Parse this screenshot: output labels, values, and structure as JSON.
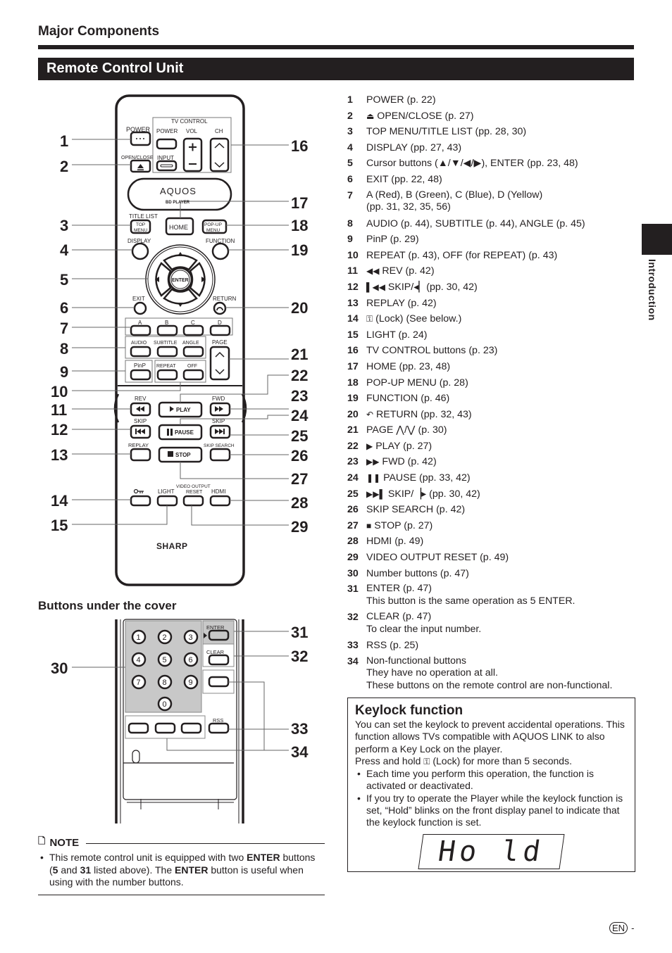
{
  "header": {
    "section_title": "Major Components",
    "page_title": "Remote Control Unit",
    "side_tab_label": "Introduction"
  },
  "remote": {
    "tv_control_label": "TV CONTROL",
    "power_label": "POWER",
    "tv_power_label": "POWER",
    "vol_label": "VOL",
    "ch_label": "CH",
    "open_close_label": "OPEN/CLOSE",
    "input_label": "INPUT",
    "brand_logo": "AQUOS",
    "brand_sub": "BD PLAYER",
    "title_list_label": "TITLE LIST",
    "top_menu_label_1": "TOP",
    "top_menu_label_2": "MENU",
    "home_label": "HOME",
    "popup_label_1": "POP-UP",
    "popup_label_2": "MENU",
    "display_label": "DISPLAY",
    "function_label": "FUNCTION",
    "enter_label": "ENTER",
    "exit_label": "EXIT",
    "return_label": "RETURN",
    "color_labels": [
      "A",
      "B",
      "C",
      "D"
    ],
    "audio_label": "AUDIO",
    "subtitle_label": "SUBTITLE",
    "angle_label": "ANGLE",
    "page_label": "PAGE",
    "pinp_label": "PinP",
    "repeat_label": "REPEAT",
    "off_label": "OFF",
    "rev_label": "REV",
    "play_label": "PLAY",
    "fwd_label": "FWD",
    "skip_label": "SKIP",
    "pause_label": "PAUSE",
    "replay_label": "REPLAY",
    "stop_label": "STOP",
    "skip_search_label": "SKIP SEARCH",
    "light_label": "LIGHT",
    "video_output_label": "VIDEO OUTPUT",
    "reset_label": "RESET",
    "hdmi_label": "HDMI",
    "maker_logo": "SHARP",
    "callouts_left": [
      "1",
      "2",
      "3",
      "4",
      "5",
      "6",
      "7",
      "8",
      "9",
      "10",
      "11",
      "12",
      "13",
      "14",
      "15"
    ],
    "callouts_right": [
      "16",
      "17",
      "18",
      "19",
      "20",
      "21",
      "22",
      "23",
      "24",
      "25",
      "26",
      "27",
      "28",
      "29"
    ]
  },
  "cover": {
    "heading": "Buttons under the cover",
    "digits": [
      "1",
      "2",
      "3",
      "4",
      "5",
      "6",
      "7",
      "8",
      "9",
      "0"
    ],
    "enter_label": "ENTER",
    "clear_label": "CLEAR",
    "rss_label": "RSS",
    "callouts": [
      "30",
      "31",
      "32",
      "33",
      "34"
    ]
  },
  "items": [
    {
      "num": "1",
      "text": "POWER (p. 22)"
    },
    {
      "num": "2",
      "icon": "eject-icon",
      "glyph": "⏏",
      "text": "OPEN/CLOSE (p. 27)"
    },
    {
      "num": "3",
      "text": "TOP MENU/TITLE LIST (pp. 28, 30)"
    },
    {
      "num": "4",
      "text": "DISPLAY (pp. 27, 43)"
    },
    {
      "num": "5",
      "text": "Cursor buttons (▲/▼/◀/▶), ENTER (pp. 23, 48)"
    },
    {
      "num": "6",
      "text": "EXIT (pp. 22, 48)"
    },
    {
      "num": "7",
      "text": "A (Red), B (Green), C (Blue), D (Yellow)",
      "text2": "(pp. 31, 32, 35, 56)"
    },
    {
      "num": "8",
      "text": "AUDIO (p. 44), SUBTITLE (p. 44), ANGLE (p. 45)"
    },
    {
      "num": "9",
      "text": "PinP (p. 29)"
    },
    {
      "num": "10",
      "text": "REPEAT (p. 43), OFF (for REPEAT) (p. 43)"
    },
    {
      "num": "11",
      "icon": "rewind-icon",
      "glyph": "◀◀",
      "text": "REV (p. 42)"
    },
    {
      "num": "12",
      "icon": "skip-back-icon",
      "glyph": "▌◀◀",
      "text": "SKIP/◂▏(pp. 30, 42)"
    },
    {
      "num": "13",
      "text": "REPLAY (p. 42)"
    },
    {
      "num": "14",
      "icon": "key-lock-icon",
      "glyph": "⚿",
      "text": "(Lock) (See below.)"
    },
    {
      "num": "15",
      "text": "LIGHT (p. 24)"
    },
    {
      "num": "16",
      "text": "TV CONTROL buttons (p. 23)"
    },
    {
      "num": "17",
      "text": "HOME (pp. 23, 48)"
    },
    {
      "num": "18",
      "text": "POP-UP MENU (p. 28)"
    },
    {
      "num": "19",
      "text": "FUNCTION (p. 46)"
    },
    {
      "num": "20",
      "icon": "return-icon",
      "glyph": "↶",
      "text": "RETURN (pp. 32, 43)"
    },
    {
      "num": "21",
      "text": "PAGE ⋀/⋁ (p. 30)"
    },
    {
      "num": "22",
      "icon": "play-icon",
      "glyph": "▶",
      "text": "PLAY (p. 27)"
    },
    {
      "num": "23",
      "icon": "fast-forward-icon",
      "glyph": "▶▶",
      "text": "FWD (p. 42)"
    },
    {
      "num": "24",
      "icon": "pause-icon",
      "glyph": "❚❚",
      "text": "PAUSE (pp. 33, 42)"
    },
    {
      "num": "25",
      "icon": "skip-forward-icon",
      "glyph": "▶▶▌",
      "text": "SKIP/▕▸ (pp. 30, 42)"
    },
    {
      "num": "26",
      "text": "SKIP SEARCH (p. 42)"
    },
    {
      "num": "27",
      "icon": "stop-icon",
      "glyph": "■",
      "text": "STOP (p. 27)"
    },
    {
      "num": "28",
      "text": "HDMI (p. 49)"
    },
    {
      "num": "29",
      "text": "VIDEO OUTPUT RESET (p. 49)"
    },
    {
      "num": "30",
      "text": "Number buttons (p. 47)"
    },
    {
      "num": "31",
      "text": "ENTER (p. 47)",
      "text2": "This button is the same operation as 5 ENTER."
    },
    {
      "num": "32",
      "text": "CLEAR (p. 47)",
      "text2": "To clear the input number."
    },
    {
      "num": "33",
      "text": "RSS (p. 25)"
    },
    {
      "num": "34",
      "text": "Non-functional buttons",
      "text2": "They have no operation at all.",
      "text3": "These buttons on the remote control are non-functional."
    }
  ],
  "keylock": {
    "title": "Keylock function",
    "para1": "You can set the keylock to prevent accidental operations. This function allows TVs compatible with AQUOS LINK to also perform a Key Lock on the player.",
    "para2_pre": "Press and hold",
    "para2_post": "(Lock) for more than 5 seconds.",
    "bullets": [
      "Each time you perform this operation, the function is activated or deactivated.",
      "If you try to operate the Player while the keylock function is set, “Hold” blinks on the front display panel to indicate that the keylock function is set."
    ],
    "display_text": "Ho ld"
  },
  "note": {
    "heading": "NOTE",
    "pre": "This remote control unit is equipped with two",
    "b1": "ENTER",
    "mid1": "buttons (",
    "b2": "5",
    "mid2": "and",
    "b3": "31",
    "mid3": "listed above). The",
    "b4": "ENTER",
    "post": "button is useful when using with the number buttons."
  },
  "footer": {
    "lang_badge": "EN",
    "page_suffix": "-"
  }
}
